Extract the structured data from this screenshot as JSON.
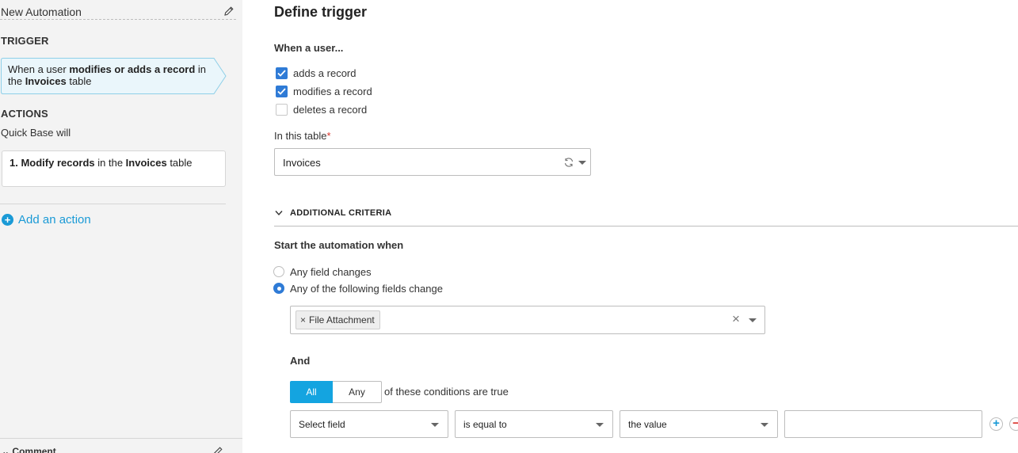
{
  "sidebar": {
    "automation_title": "New Automation",
    "trigger_heading": "TRIGGER",
    "trigger_card": {
      "prefix": "When a user ",
      "bold_action": "modifies or adds a record",
      "middle": " in the ",
      "bold_table": "Invoices",
      "suffix": " table"
    },
    "actions_heading": "ACTIONS",
    "quick_base_will": "Quick Base will",
    "action_card": {
      "bold_step": "1. Modify records",
      "middle": " in the ",
      "bold_table": "Invoices",
      "suffix": " table"
    },
    "add_action_label": "Add an action",
    "comment_label": "Comment"
  },
  "main": {
    "title": "Define trigger",
    "when_user_label": "When a user...",
    "checkboxes": [
      {
        "label": "adds a record",
        "checked": true
      },
      {
        "label": "modifies a record",
        "checked": true
      },
      {
        "label": "deletes a record",
        "checked": false
      }
    ],
    "table_label": "In this table",
    "table_required_mark": "*",
    "table_value": "Invoices",
    "criteria_heading": "ADDITIONAL CRITERIA",
    "start_when_label": "Start the automation when",
    "radios": [
      {
        "label": "Any field changes",
        "selected": false
      },
      {
        "label": "Any of the following fields change",
        "selected": true
      }
    ],
    "field_tags": [
      {
        "x": "×",
        "label": "File Attachment"
      }
    ],
    "clear_symbol": "×",
    "and_label": "And",
    "match_toggle": {
      "all": "All",
      "any": "Any",
      "selected": "All"
    },
    "conditions_text": "of these conditions are true",
    "condition": {
      "field": "Select field",
      "operator": "is equal to",
      "compare_type": "the value",
      "value": ""
    },
    "add_symbol": "+",
    "remove_symbol": "−"
  },
  "colors": {
    "accent_blue": "#14a4e0",
    "checkbox_blue": "#2f7bd6",
    "link_blue": "#1a9ad6",
    "required_red": "#d9342b",
    "sidebar_bg": "#f3f3f3",
    "trigger_card_bg": "#eaf6fb"
  }
}
